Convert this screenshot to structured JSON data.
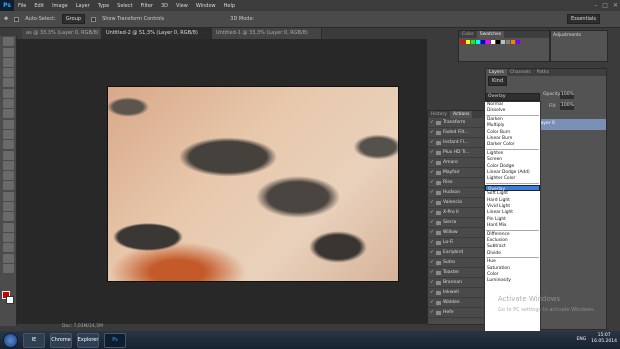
{
  "app": {
    "logo": "Ps"
  },
  "menu": [
    "File",
    "Edit",
    "Image",
    "Layer",
    "Type",
    "Select",
    "Filter",
    "3D",
    "View",
    "Window",
    "Help"
  ],
  "window_controls": [
    "–",
    "□",
    "✕"
  ],
  "options": {
    "auto_select": "Auto-Select:",
    "auto_select_value": "Group",
    "show_transform": "Show Transform Controls",
    "mode_3d": "3D Mode:",
    "workspace": "Essentials"
  },
  "tabs": [
    "as @ 33,3% (Layer 0, RGB/8)",
    "Untitled-2 @ 51,3% (Layer 0, RGB/8)",
    "Untitled-1 @ 33,3% (Layer 0, RGB/8)"
  ],
  "status": {
    "doc": "Doc: 7,03M/24,5M"
  },
  "color_panel": {
    "tabs": [
      "Color",
      "Swatches"
    ],
    "swatches": [
      "#ff0000",
      "#ffff00",
      "#00ff00",
      "#00ffff",
      "#0000ff",
      "#ff00ff",
      "#ffffff",
      "#000000",
      "#c0c0c0",
      "#808080",
      "#ff8000",
      "#8000ff"
    ]
  },
  "adjustments": {
    "title": "Adjustments"
  },
  "history": {
    "tabs": [
      "History",
      "Actions"
    ],
    "rows": [
      "Transform",
      "Faded Filt...",
      "Instant Fl...",
      "Plus HD Tr...",
      "Amaro",
      "Mayfair",
      "Rise",
      "Hudson",
      "Valencia",
      "X-Pro II",
      "Sierra",
      "Willow",
      "Lo-Fi",
      "Earlybird",
      "Sutro",
      "Toaster",
      "Brannan",
      "Inkwell",
      "Walden",
      "Hefe"
    ]
  },
  "layers": {
    "tabs": [
      "Layers",
      "Channels",
      "Paths"
    ],
    "kind": "Kind",
    "blend_mode": "Overlay",
    "opacity_label": "Opacity:",
    "opacity": "100%",
    "fill_label": "Fill:",
    "fill": "100%",
    "layer_name": "Layer 0"
  },
  "blend_modes": {
    "selected": "Overlay",
    "groups": [
      [
        "Normal",
        "Dissolve"
      ],
      [
        "Darken",
        "Multiply",
        "Color Burn",
        "Linear Burn",
        "Darker Color"
      ],
      [
        "Lighten",
        "Screen",
        "Color Dodge",
        "Linear Dodge (Add)",
        "Lighter Color"
      ],
      [
        "Overlay",
        "Soft Light",
        "Hard Light",
        "Vivid Light",
        "Linear Light",
        "Pin Light",
        "Hard Mix"
      ],
      [
        "Difference",
        "Exclusion",
        "Subtract",
        "Divide"
      ],
      [
        "Hue",
        "Saturation",
        "Color",
        "Luminosity"
      ]
    ]
  },
  "watermark": {
    "line1": "Activate Windows",
    "line2": "Go to PC settings to activate Windows."
  },
  "taskbar": {
    "apps": [
      "IE",
      "Chrome",
      "Explorer",
      "Ps"
    ],
    "lang": "ENG",
    "time": "15:07",
    "date": "16.05.2014"
  }
}
